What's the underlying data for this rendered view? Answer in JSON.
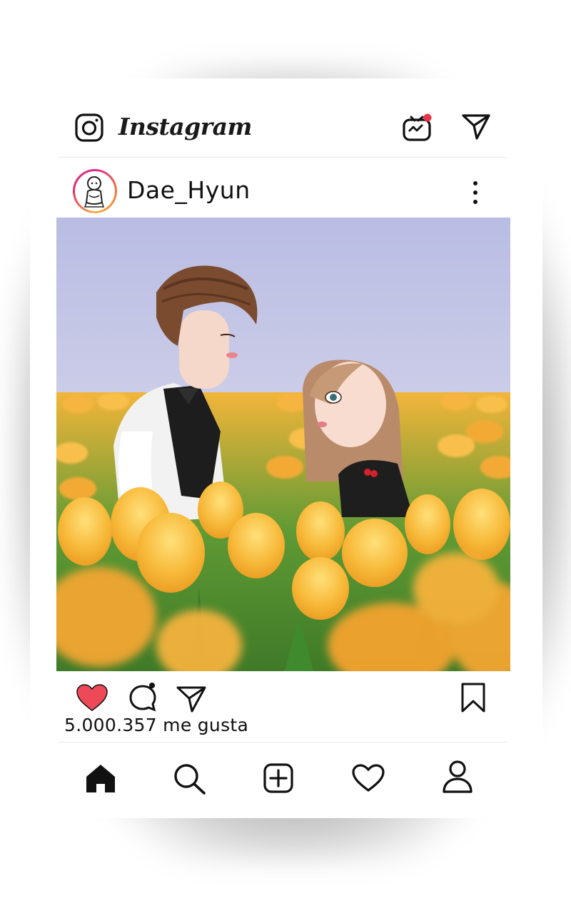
{
  "header": {
    "brand": "Instagram",
    "icons": [
      "camera-icon",
      "igtv-icon",
      "direct-message-icon"
    ],
    "igtv_badge_color": "#e8334a"
  },
  "post": {
    "username": "Dae_Hyun",
    "likes_text": "5.000.357 me gusta",
    "liked": true,
    "like_color": "#ed4956",
    "actions": [
      "heart-icon",
      "comment-icon",
      "share-icon",
      "bookmark-icon"
    ]
  },
  "bottom_nav": {
    "items": [
      "home-icon",
      "search-icon",
      "new-post-icon",
      "activity-icon",
      "profile-icon"
    ]
  }
}
